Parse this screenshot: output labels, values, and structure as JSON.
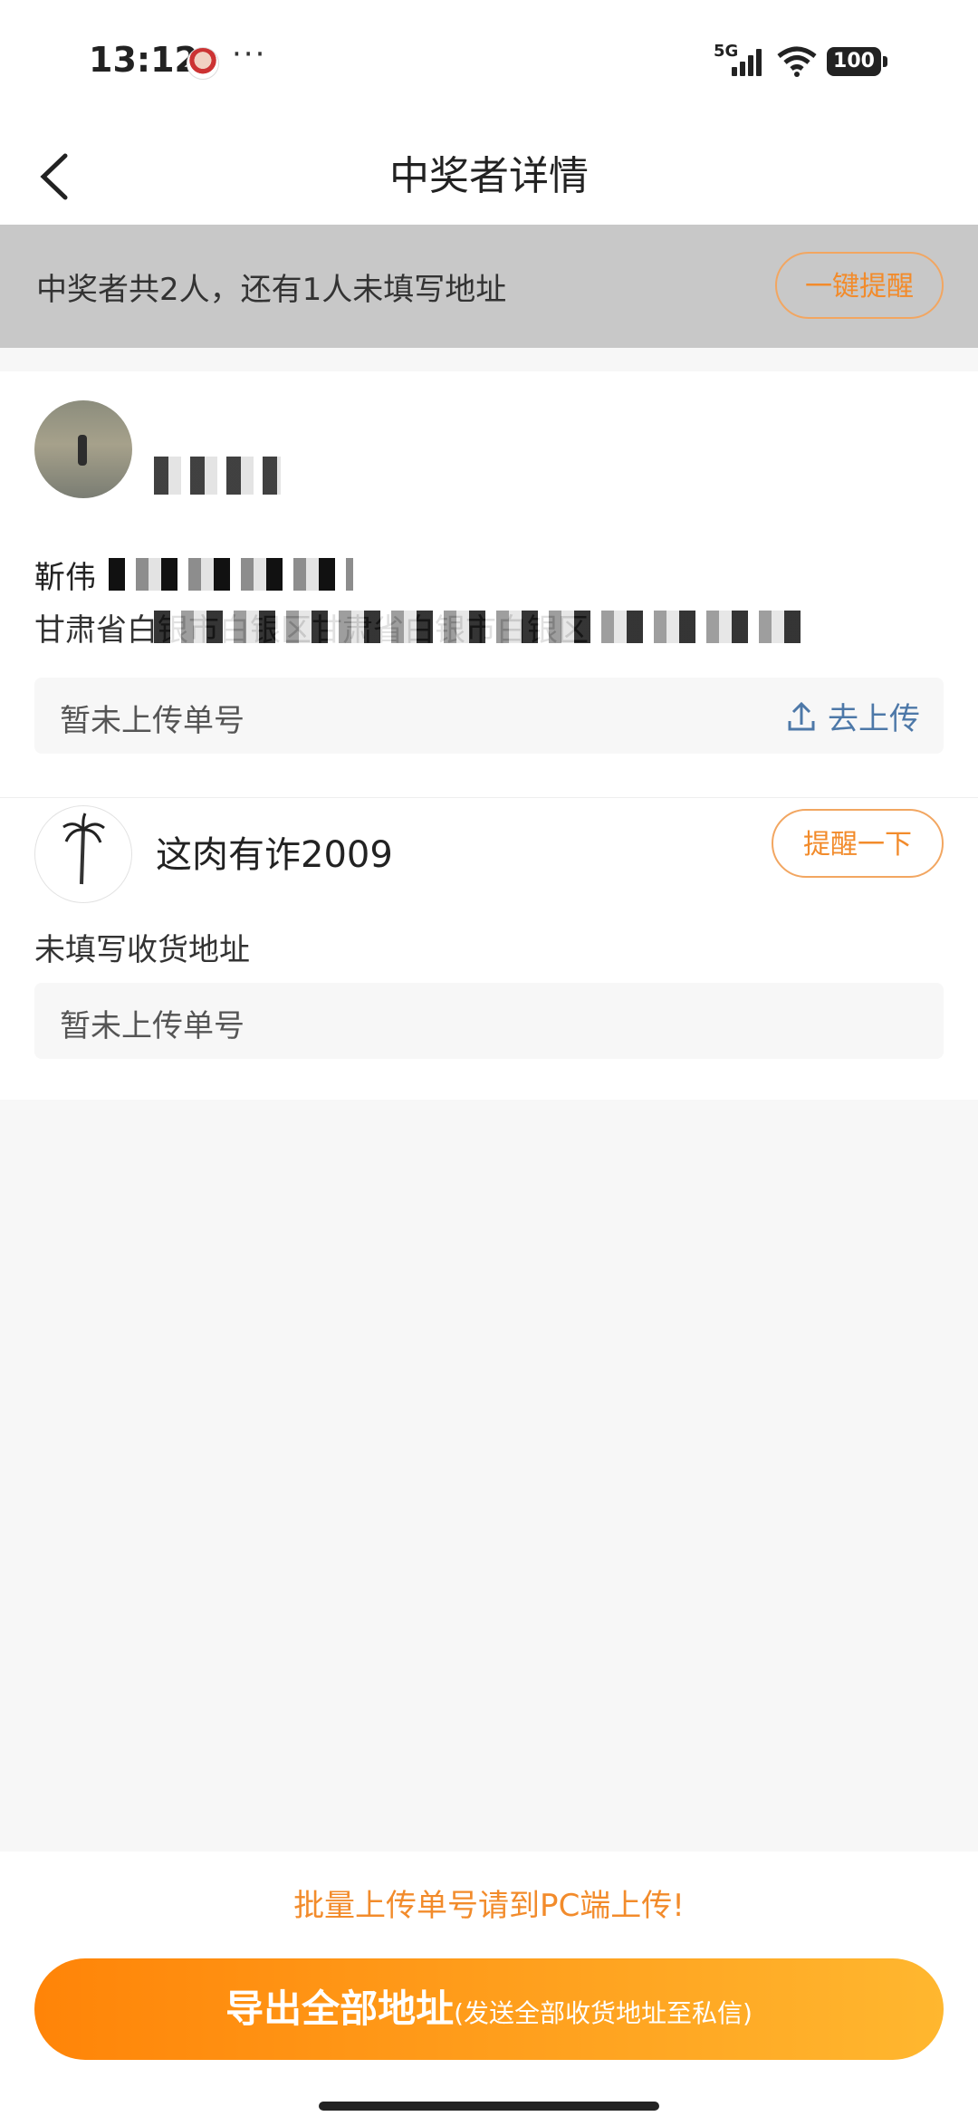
{
  "status_bar": {
    "time": "13:12",
    "more": "···",
    "network": "5G",
    "battery": "100"
  },
  "nav": {
    "back_icon": "chevron-left-icon",
    "title": "中奖者详情"
  },
  "summary": {
    "text": "中奖者共2人，还有1人未填写地址",
    "remind_all_label": "一键提醒"
  },
  "winners": [
    {
      "name": "",
      "phone": "靳伟",
      "address": "甘肃省白银市白银区甘肃省白银市白银区",
      "tracking_text": "暂未上传单号",
      "upload_label": "去上传"
    },
    {
      "name": "这肉有诈2009",
      "remind_label": "提醒一下",
      "address_status": "未填写收货地址",
      "tracking_text": "暂未上传单号"
    }
  ],
  "footer": {
    "tip": "批量上传单号请到PC端上传!",
    "export_label": "导出全部地址",
    "export_sub": "(发送全部收货地址至私信)"
  },
  "colors": {
    "accent": "#f28b2b",
    "link": "#4d78a8",
    "summary_bg": "#c8c8c8"
  }
}
